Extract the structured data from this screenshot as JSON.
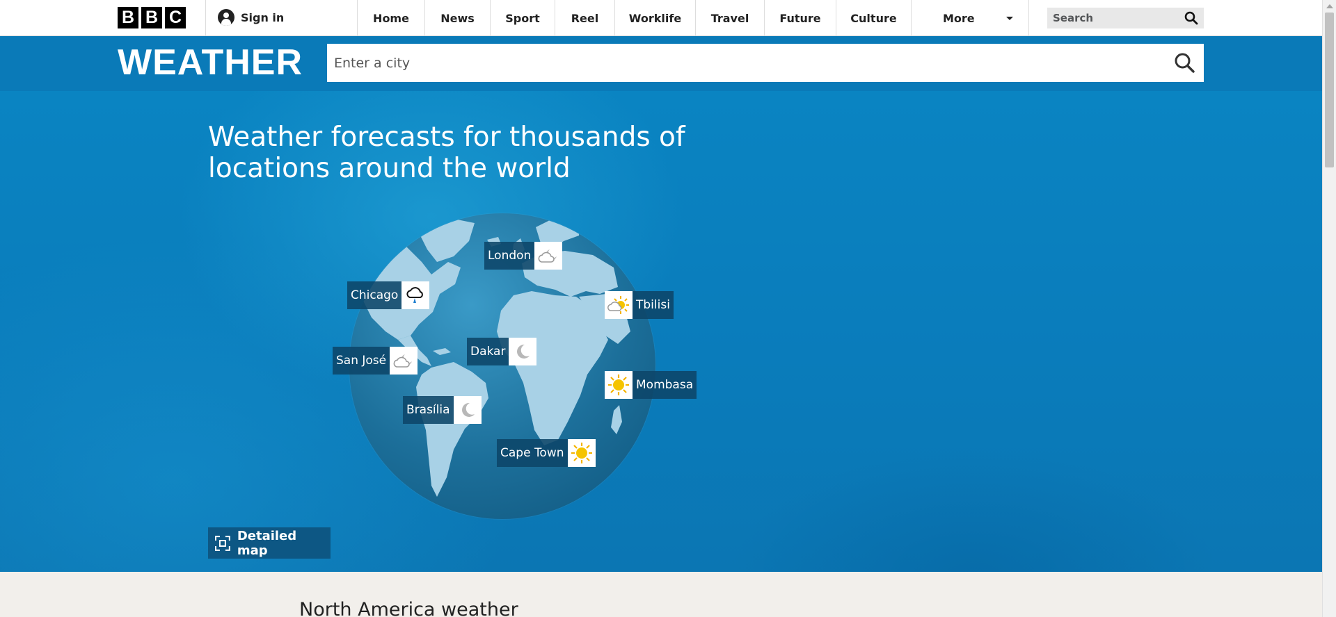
{
  "topbar": {
    "logo_letters": [
      "B",
      "B",
      "C"
    ],
    "signin_label": "Sign in",
    "nav_items": [
      "Home",
      "News",
      "Sport",
      "Reel",
      "Worklife",
      "Travel",
      "Future",
      "Culture"
    ],
    "more_label": "More",
    "search_placeholder": "Search"
  },
  "weather_bar": {
    "title": "WEATHER",
    "city_search_placeholder": "Enter a city",
    "bar_color": "#0a7ab8"
  },
  "hero": {
    "title": "Weather forecasts for thousands of locations around the world",
    "detailed_map_label": "Detailed map",
    "locations": [
      {
        "name": "London",
        "icon": "cloud-moon-icon"
      },
      {
        "name": "Chicago",
        "icon": "rain-cloud-icon"
      },
      {
        "name": "Tbilisi",
        "icon": "sun-cloud-icon"
      },
      {
        "name": "Dakar",
        "icon": "moon-icon"
      },
      {
        "name": "San José",
        "icon": "cloud-moon-icon"
      },
      {
        "name": "Mombasa",
        "icon": "sun-icon"
      },
      {
        "name": "Brasília",
        "icon": "moon-icon"
      },
      {
        "name": "Cape Town",
        "icon": "sun-icon"
      }
    ]
  },
  "sections": {
    "north_america_title": "North America weather"
  }
}
